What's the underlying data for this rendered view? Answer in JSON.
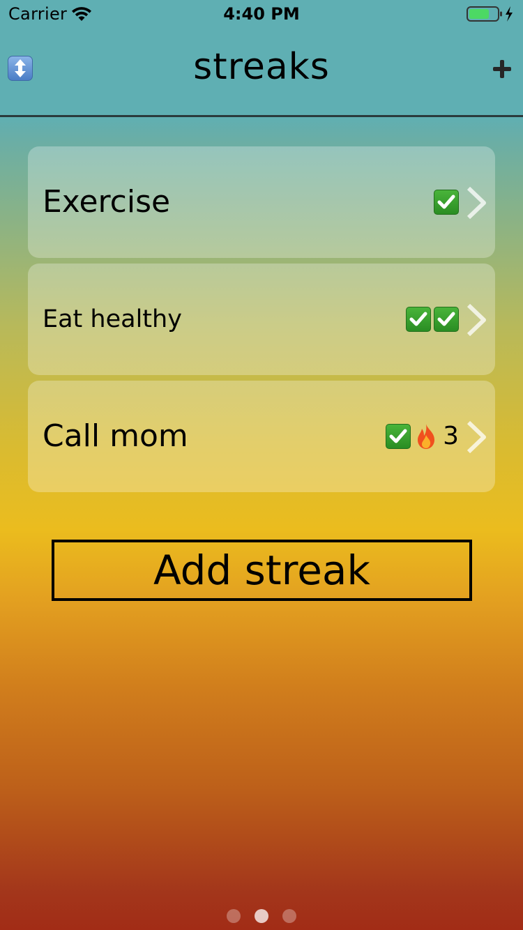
{
  "status_bar": {
    "carrier": "Carrier",
    "time": "4:40 PM",
    "battery_color": "#4cd964"
  },
  "nav": {
    "title": "streaks",
    "left_icon": "up-down-arrow-icon",
    "right_icon": "plus-icon"
  },
  "streaks": [
    {
      "name": "Exercise",
      "checks": 1,
      "fire_count": ""
    },
    {
      "name": "Eat healthy",
      "checks": 2,
      "fire_count": ""
    },
    {
      "name": "Call mom",
      "checks": 1,
      "fire_count": "3"
    }
  ],
  "add_button": {
    "label": "Add streak"
  },
  "pager": {
    "pages": 3,
    "current": 2
  },
  "colors": {
    "top": "#5fafb3",
    "middle": "#ebbc1e",
    "bottom": "#a22c16",
    "check": "#3aa02e"
  }
}
